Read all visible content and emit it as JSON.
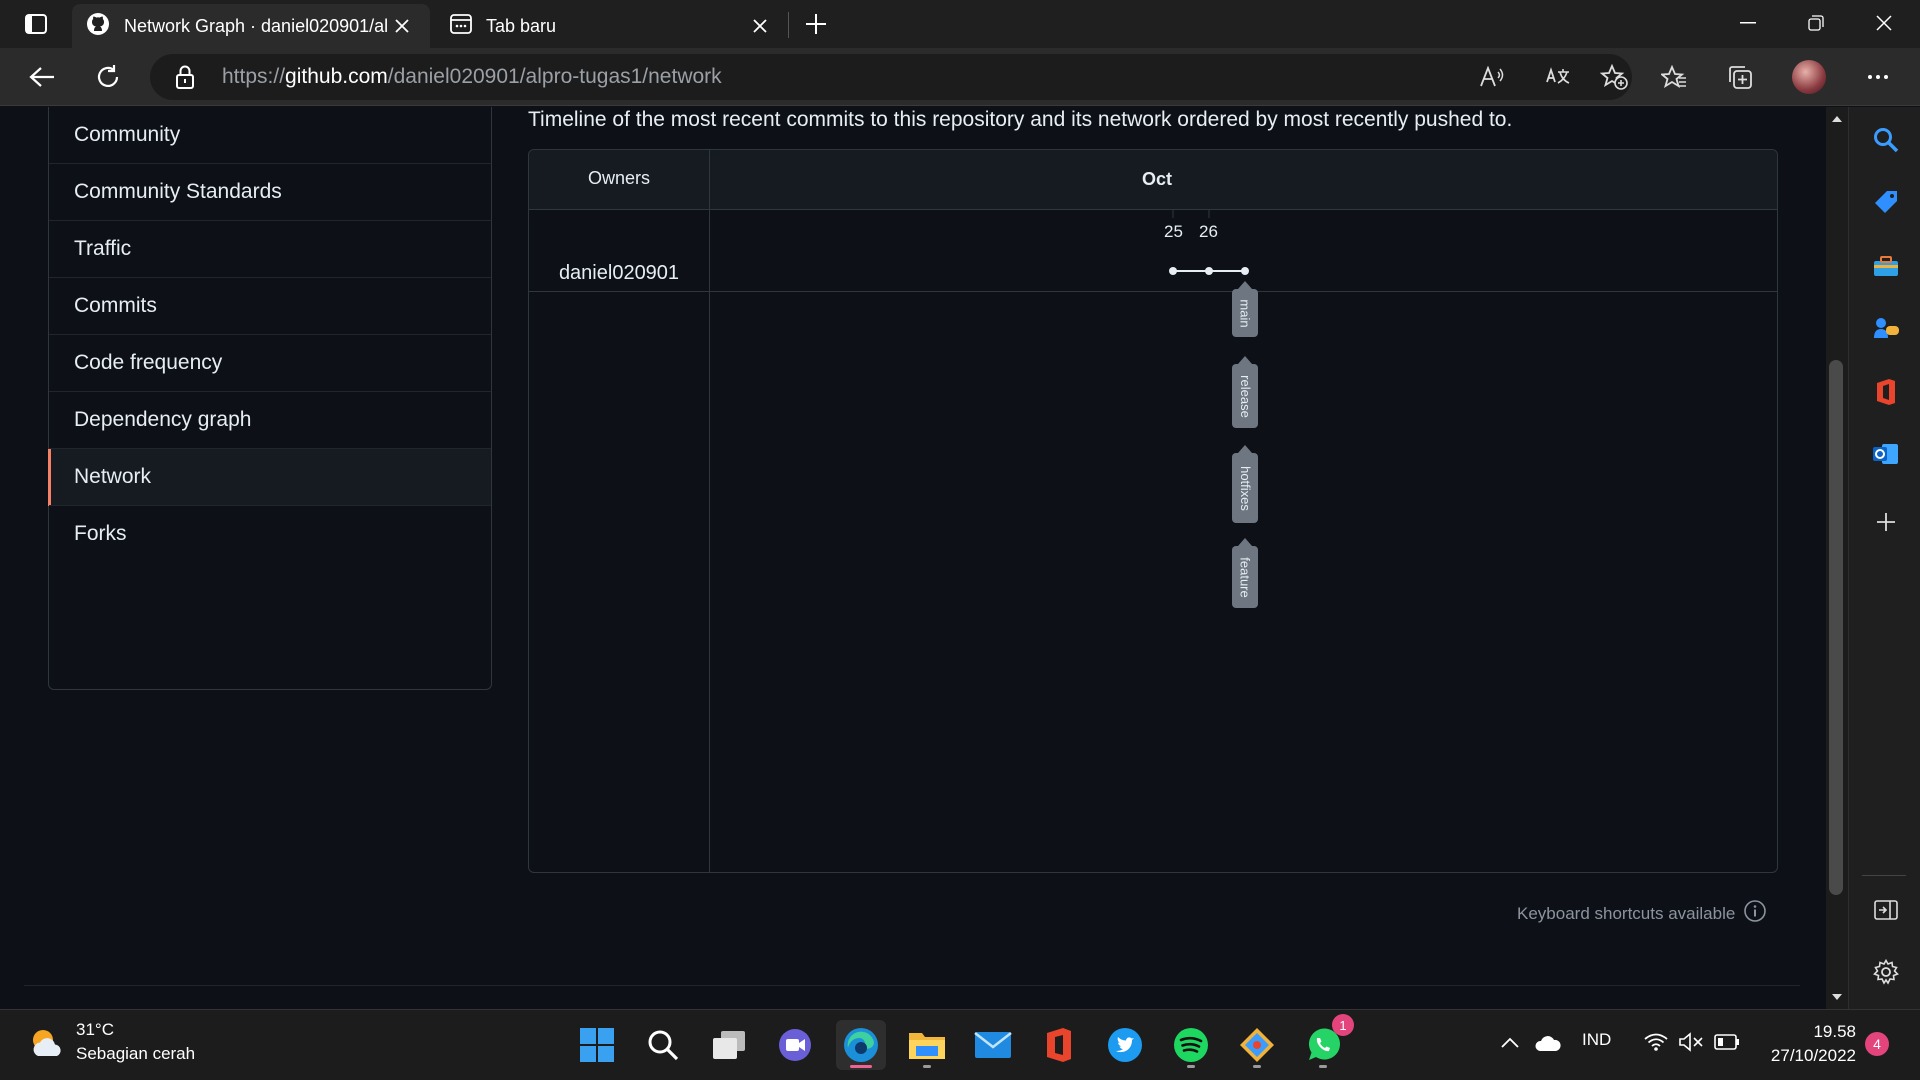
{
  "browser": {
    "tabs": [
      {
        "title": "Network Graph · daniel020901/alpro-tugas1",
        "active": true
      },
      {
        "title": "Tab baru",
        "active": false
      }
    ],
    "url_prefix": "https://",
    "url_domain": "github.com",
    "url_path": "/daniel020901/alpro-tugas1/network"
  },
  "sidebar": {
    "items": [
      {
        "label": "Community"
      },
      {
        "label": "Community Standards"
      },
      {
        "label": "Traffic"
      },
      {
        "label": "Commits"
      },
      {
        "label": "Code frequency"
      },
      {
        "label": "Dependency graph"
      },
      {
        "label": "Network",
        "selected": true
      },
      {
        "label": "Forks"
      }
    ]
  },
  "main": {
    "description": "Timeline of the most recent commits to this repository and its network ordered by most recently pushed to.",
    "network": {
      "owners_header": "Owners",
      "month": "Oct",
      "days": [
        "25",
        "26"
      ],
      "owner": "daniel020901",
      "commits": 3,
      "branches": [
        "main",
        "release",
        "hotfixes",
        "feature"
      ]
    },
    "keyboard_hint": "Keyboard shortcuts available"
  },
  "taskbar": {
    "weather_temp": "31°C",
    "weather_desc": "Sebagian cerah",
    "language": "IND",
    "time": "19.58",
    "date": "27/10/2022",
    "notifications": "4",
    "whatsapp_badge": "1"
  },
  "colors": {
    "page_bg": "#0d1117",
    "selected_accent": "#f78166",
    "branch_tag": "#6e7681"
  }
}
